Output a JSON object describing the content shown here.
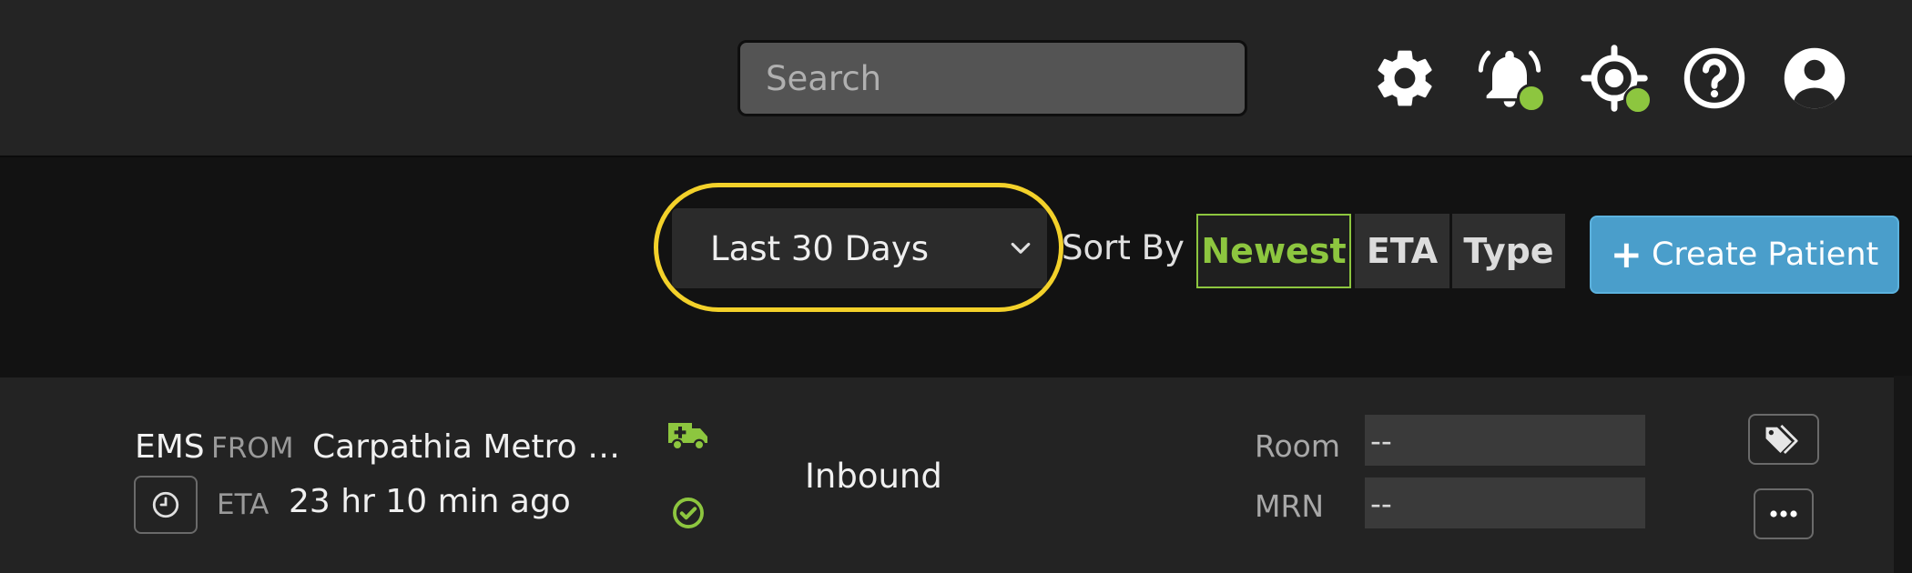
{
  "header": {
    "search": {
      "placeholder": "Search",
      "value": ""
    },
    "icons": [
      "gear-icon",
      "bell-icon",
      "target-icon",
      "help-icon",
      "user-icon"
    ],
    "indicator_color": "#8dc63f"
  },
  "toolbar": {
    "date_range": {
      "selected": "Last 30 Days",
      "highlight_color": "#f3d12a"
    },
    "sort_by_label": "Sort By",
    "sort_options": [
      {
        "label": "Newest",
        "active": true
      },
      {
        "label": "ETA",
        "active": false
      },
      {
        "label": "Type",
        "active": false
      }
    ],
    "create_button": {
      "plus": "+",
      "label": "Create Patient",
      "color": "#4a9ecb"
    }
  },
  "patient": {
    "source": "EMS",
    "from_label": "FROM",
    "origin": "Carpathia Metro Ambulance",
    "eta_label": "ETA",
    "eta_value": "23 hr 10 min ago",
    "status": "Inbound",
    "room_label": "Room",
    "room_value": "--",
    "mrn_label": "MRN",
    "mrn_value": "--",
    "accent_color": "#8dc63f"
  }
}
